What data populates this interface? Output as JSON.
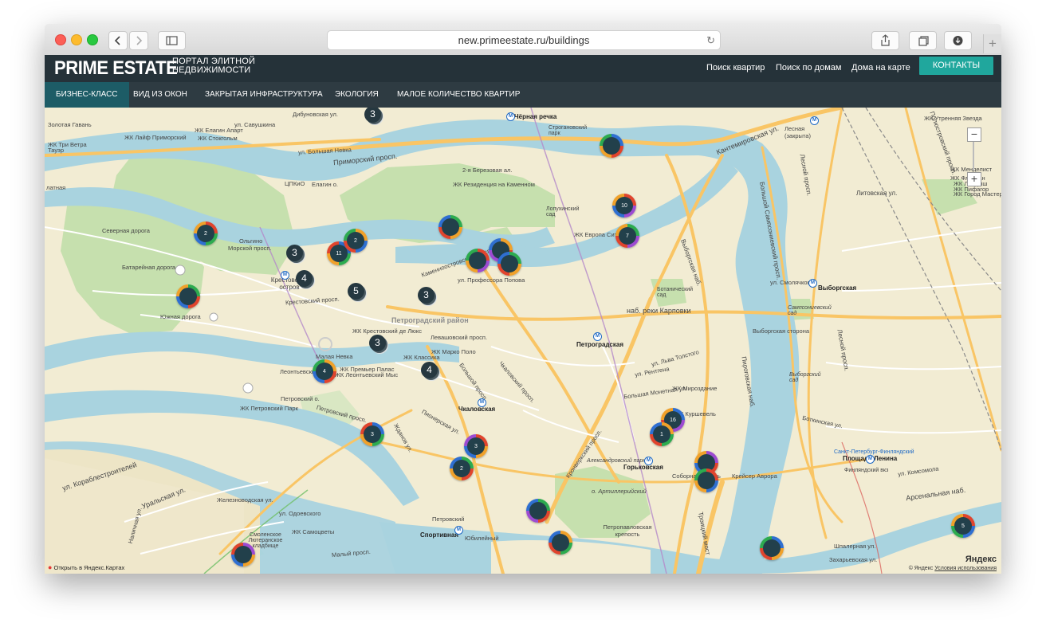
{
  "browser": {
    "url": "new.primeestate.ru/buildings",
    "reload_icon": "reload-icon",
    "newtab_icon": "plus-icon"
  },
  "header": {
    "logo": "PRIME ESTATE",
    "tagline": "ПОРТАЛ ЭЛИТНОЙ НЕДВИЖИМОСТИ",
    "nav": [
      "Поиск квартир",
      "Поиск по домам",
      "Дома на карте"
    ],
    "contacts": "КОНТАКТЫ"
  },
  "subnav": [
    "БИЗНЕС-КЛАСС",
    "ВИД ИЗ ОКОН",
    "ЗАКРЫТАЯ ИНФРАСТРУКТУРА",
    "ЭКОЛОГИЯ",
    "МАЛОЕ КОЛИЧЕСТВО КВАРТИР"
  ],
  "colors": {
    "header": "#253239",
    "subnav": "#2e3b42",
    "active_tab": "#1d5c66",
    "accent": "#20a79d",
    "water": "#a9d3df",
    "park": "#c6e0ae",
    "road": "#f9c565",
    "marker": "#22404b"
  },
  "map": {
    "labels": [
      "Золотая Гавань",
      "ул. Савушкина",
      "ЖК Елагин Апарт",
      "ЖК Стокгольм",
      "ЖК Лайф Приморский",
      "ЖК Три Ветра",
      "Тауэр",
      "латная",
      "Приморский просп.",
      "ул. Большая Невка",
      "Чёрная речка",
      "Строгановский парк",
      "Дибуновская ул.",
      "Лесная (закрыта)",
      "ЖК Утренняя Звезда",
      "Кантемировская ул.",
      "Полюстровский просп.",
      "ЖК Менделист",
      "ЖК Флагман",
      "ЖК Ландыш",
      "ЖК Пифагор",
      "ЖК Город Мастеров",
      "Литовская ул.",
      "Большой Сампсониевский просп.",
      "Лесной просп.",
      "ЦПКиО",
      "Елагин о.",
      "2-я Березовая ал.",
      "ЖК Резиденция на Каменном",
      "Лопухинский сад",
      "ЖК Европа Сити",
      "Северная дорога",
      "Батарейная дорога",
      "Крестовский остров",
      "Крестовский просп.",
      "Южная дорога",
      "Ольгино",
      "Морской просп.",
      "Каменноостровский просп.",
      "ул. Профессора Попова",
      "Петроградский район",
      "Левашовский просп.",
      "Петроградская",
      "Ботанический сад",
      "наб. реки Карповки",
      "Выборгская сторона",
      "Выборгская",
      "ул. Смолячкова",
      "Сампсониевский сад",
      "Выборгский сад",
      "ЖК Крестовский де Люкс",
      "ЖК Классика",
      "ЖК Марко Поло",
      "Малая Невка",
      "Леонтьевский мыс",
      "ЖК Премьер Палас",
      "ЖК Леонтьевский Мыс",
      "ЖК Петровский Парк",
      "Петровский просп.",
      "Петровский о.",
      "Чкаловская",
      "Пионерская ул.",
      "Большой просп.",
      "Жданов ул.",
      "Чкаловский просп.",
      "ул. Льва Толстого",
      "ул. Рентгена",
      "Большая Монетная ул.",
      "ЖК Мироздание",
      "ЖК Куршевель",
      "Горьковская",
      "Соборная мечеть",
      "Крейсер Аврора",
      "Петропавловская крепость",
      "Александровский парк",
      "о. Артиллерийский",
      "Кронверкский просп.",
      "Площадь Ленина",
      "Финляндский вкз",
      "Санкт-Петербург-Финляндский",
      "Боткинская ул.",
      "ул. Комсомола",
      "Арсенальная наб.",
      "Шпалерная ул.",
      "Захарьевская ул.",
      "Спортивная",
      "Петровский",
      "Юбилейный",
      "Уральская ул.",
      "Железноводская ул.",
      "ул. Одоевского",
      "ЖК Самоцветы",
      "Смоленское Лютеранское кладбище",
      "ул. Кораблестроителей",
      "Наличная ул.",
      "Малый просп.",
      "Троицкий мост",
      "Пироговская наб.",
      "Выборгская наб.",
      "Лесной просп."
    ],
    "markers": [
      {
        "label": "2",
        "colors": [
          "#e0442d",
          "#2dab4f",
          "#2f6fd1",
          "#f0a12a"
        ]
      },
      {
        "label": "",
        "colors": [
          "#2dab4f",
          "#e0442d",
          "#2f6fd1",
          "#f0a12a"
        ]
      },
      {
        "label": "11",
        "colors": [
          "#2f6fd1",
          "#2dab4f",
          "#f0a12a",
          "#e0442d"
        ]
      },
      {
        "label": "2",
        "colors": [
          "#f0a12a",
          "#2f6fd1",
          "#e0442d",
          "#2dab4f"
        ]
      },
      {
        "label": "",
        "colors": [
          "#2dab4f",
          "#f0a12a",
          "#e0442d",
          "#2f6fd1"
        ]
      },
      {
        "label": "",
        "colors": [
          "#e0442d",
          "#9d4bd1",
          "#f0a12a",
          "#2dab4f"
        ]
      },
      {
        "label": "",
        "colors": [
          "#f0a12a",
          "#e0442d",
          "#9d4bd1",
          "#2f6fd1"
        ]
      },
      {
        "label": "",
        "colors": [
          "#2dab4f",
          "#f0a12a",
          "#e0442d",
          "#2f6fd1"
        ]
      },
      {
        "label": "",
        "colors": [
          "#2f6fd1",
          "#e0442d",
          "#f0a12a",
          "#2dab4f"
        ]
      },
      {
        "label": "10",
        "colors": [
          "#e0442d",
          "#9d4bd1",
          "#2f6fd1",
          "#f0a12a"
        ]
      },
      {
        "label": "7",
        "colors": [
          "#2dab4f",
          "#9d4bd1",
          "#e0442d",
          "#f0a12a"
        ]
      },
      {
        "label": "4",
        "colors": [
          "#f0a12a",
          "#e0442d",
          "#2f6fd1",
          "#2dab4f"
        ]
      },
      {
        "label": "3",
        "colors": [
          "#2f6fd1",
          "#2dab4f",
          "#f0a12a",
          "#e0442d"
        ]
      },
      {
        "label": "3",
        "colors": [
          "#e0442d",
          "#f0a12a",
          "#2f6fd1",
          "#9d4bd1"
        ]
      },
      {
        "label": "2",
        "colors": [
          "#2dab4f",
          "#e0442d",
          "#f0a12a",
          "#2f6fd1"
        ]
      },
      {
        "label": "16",
        "colors": [
          "#2f6fd1",
          "#9d4bd1",
          "#e0442d",
          "#f0a12a"
        ]
      },
      {
        "label": "1",
        "colors": [
          "#f0a12a",
          "#2dab4f",
          "#e0442d",
          "#2f6fd1"
        ]
      },
      {
        "label": "",
        "colors": [
          "#9d4bd1",
          "#e0442d",
          "#2f6fd1",
          "#f0a12a"
        ]
      },
      {
        "label": "",
        "colors": [
          "#e0442d",
          "#2f6fd1",
          "#f0a12a",
          "#2dab4f"
        ]
      },
      {
        "label": "",
        "colors": [
          "#2dab4f",
          "#e0442d",
          "#9d4bd1",
          "#2f6fd1"
        ]
      },
      {
        "label": "",
        "colors": [
          "#f0a12a",
          "#2dab4f",
          "#e0442d",
          "#2f6fd1"
        ]
      },
      {
        "label": "",
        "colors": [
          "#2f6fd1",
          "#f0a12a",
          "#e0442d",
          "#2dab4f"
        ]
      },
      {
        "label": "5",
        "colors": [
          "#e0442d",
          "#2f6fd1",
          "#2dab4f",
          "#f0a12a"
        ]
      },
      {
        "label": "",
        "colors": [
          "#9d4bd1",
          "#f0a12a",
          "#2f6fd1",
          "#e0442d"
        ]
      }
    ],
    "clusters": [
      "3",
      "3",
      "4",
      "5",
      "3",
      "3",
      "4"
    ],
    "zoom": {
      "in": "+",
      "out": "−"
    },
    "bottom": {
      "open_link": "Открыть в Яндекс.Картах",
      "logo": "Яндекс",
      "copyright": "© Яндекс",
      "terms": "Условия использования"
    }
  }
}
